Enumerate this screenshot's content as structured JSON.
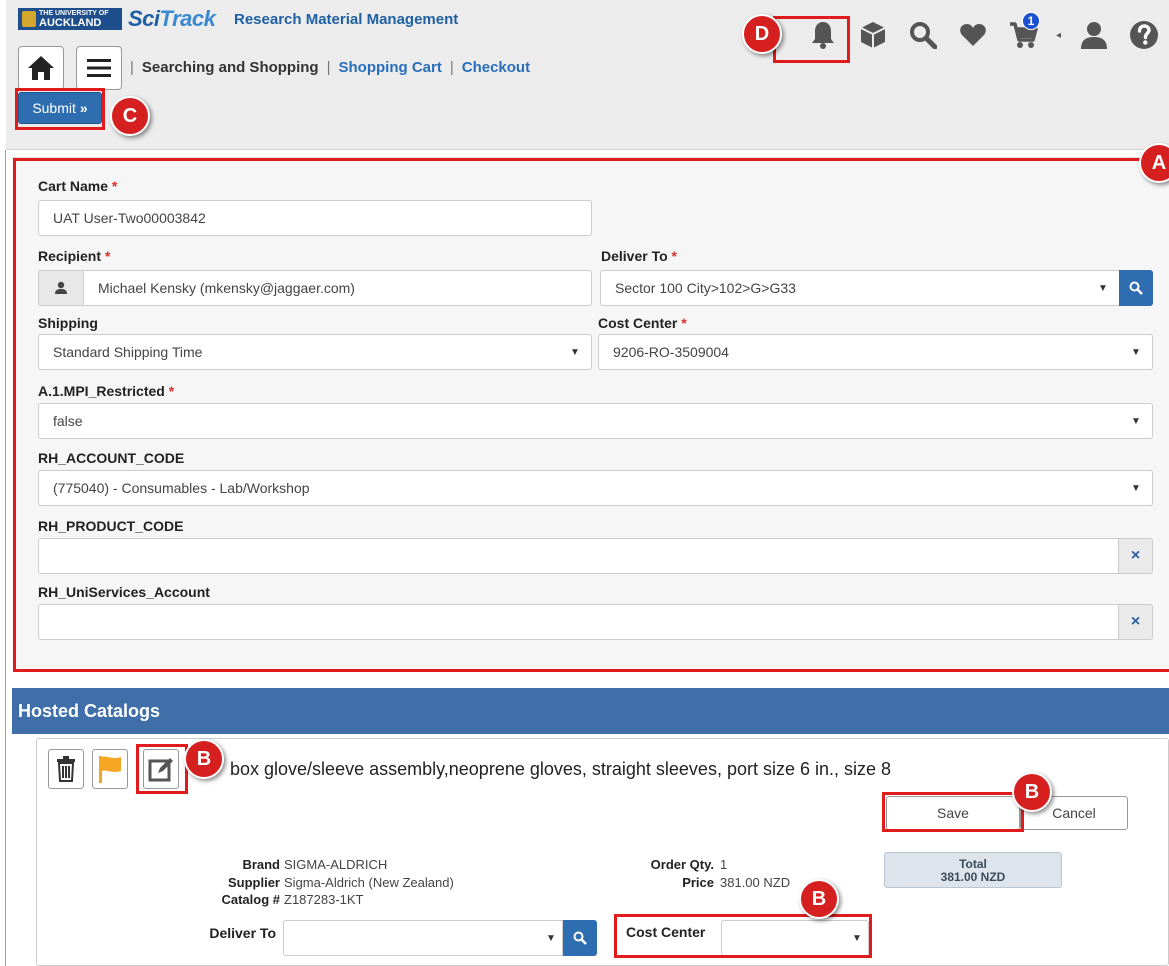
{
  "header": {
    "logo_line1": "THE UNIVERSITY OF",
    "logo_line2": "AUCKLAND",
    "brand_sci": "Sci",
    "brand_track": "Track",
    "subtitle": "Research Material Management",
    "nav": {
      "searching": "Searching and Shopping",
      "cart": "Shopping Cart",
      "checkout": "Checkout",
      "separator": "|"
    },
    "submit_label": "Submit",
    "submit_glyph": "»",
    "cart_count": "1"
  },
  "callouts": {
    "a": "A",
    "b": "B",
    "c": "C",
    "d": "D"
  },
  "form": {
    "cart_name": {
      "label": "Cart Name",
      "value": "UAT User-Two00003842"
    },
    "recipient": {
      "label": "Recipient",
      "value": "Michael Kensky (mkensky@jaggaer.com)"
    },
    "deliver_to": {
      "label": "Deliver To",
      "value": "Sector 100 City>102>G>G33"
    },
    "shipping": {
      "label": "Shipping",
      "value": "Standard Shipping Time"
    },
    "cost_center": {
      "label": "Cost Center",
      "value": "9206-RO-3509004"
    },
    "mpi_restricted": {
      "label": "A.1.MPI_Restricted",
      "value": "false"
    },
    "account_code": {
      "label": "RH_ACCOUNT_CODE",
      "value": "(775040) - Consumables - Lab/Workshop"
    },
    "product_code": {
      "label": "RH_PRODUCT_CODE",
      "value": ""
    },
    "uniservices": {
      "label": "RH_UniServices_Account",
      "value": ""
    },
    "required_mark": "*",
    "clear_glyph": "×"
  },
  "catalog": {
    "section_title": "Hosted Catalogs",
    "product_title": "box glove/sleeve assembly,neoprene gloves, straight sleeves, port size 6 in., size 8",
    "save_label": "Save",
    "cancel_label": "Cancel",
    "brand_label": "Brand",
    "brand_value": "SIGMA-ALDRICH",
    "supplier_label": "Supplier",
    "supplier_value": "Sigma-Aldrich (New Zealand)",
    "catalog_label": "Catalog #",
    "catalog_value": "Z187283-1KT",
    "deliver_to_label": "Deliver To",
    "deliver_to_value": "",
    "order_qty_label": "Order Qty.",
    "order_qty_value": "1",
    "price_label": "Price",
    "price_value": "381.00 NZD",
    "total_label": "Total",
    "total_value": "381.00 NZD",
    "cost_center_label": "Cost Center",
    "cost_center_value": ""
  },
  "colors": {
    "primary": "#2f6db1",
    "header_band": "#3f6ea8",
    "callout": "#d62020",
    "required": "#d9302f",
    "flag": "#f5a623"
  },
  "icons": [
    "home-icon",
    "menu-icon",
    "bell-icon",
    "cube-icon",
    "search-icon",
    "heart-icon",
    "cart-icon",
    "user-icon",
    "help-icon",
    "trash-icon",
    "flag-icon",
    "edit-icon"
  ]
}
